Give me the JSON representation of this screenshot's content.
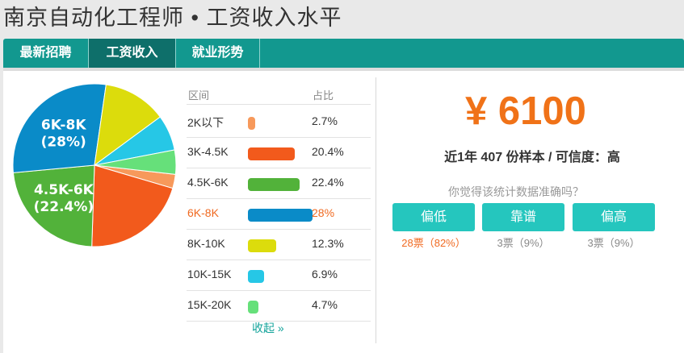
{
  "page": {
    "title": "南京自动化工程师 • 工资收入水平"
  },
  "tabs": [
    {
      "label": "最新招聘",
      "active": false
    },
    {
      "label": "工资收入",
      "active": true
    },
    {
      "label": "就业形势",
      "active": false
    }
  ],
  "colors": {
    "accent": "#12988f",
    "salary": "#f07218",
    "vote_button": "#25c6be"
  },
  "chart_data": {
    "type": "pie",
    "slices": [
      {
        "label": "2K以下",
        "value": 2.7,
        "color": "#f7995b",
        "pie_label": ""
      },
      {
        "label": "3K-4.5K",
        "value": 20.4,
        "color": "#f25a1c",
        "pie_label": ""
      },
      {
        "label": "4.5K-6K",
        "value": 22.4,
        "color": "#52b23a",
        "pie_label": "4.5K-6K\n(22.4%)"
      },
      {
        "label": "6K-8K",
        "value": 28,
        "color": "#0a8bc8",
        "pie_label": "6K-8K\n(28%)"
      },
      {
        "label": "8K-10K",
        "value": 12.3,
        "color": "#dcdc0c",
        "pie_label": ""
      },
      {
        "label": "10K-15K",
        "value": 6.9,
        "color": "#26c7e6",
        "pie_label": ""
      },
      {
        "label": "15K-20K",
        "value": 4.7,
        "color": "#66e07a",
        "pie_label": ""
      }
    ]
  },
  "table": {
    "col_range": "区间",
    "col_share": "占比",
    "rows": [
      {
        "range": "2K以下",
        "share": "2.7%",
        "value": 2.7,
        "color": "#f7995b",
        "highlight": false
      },
      {
        "range": "3K-4.5K",
        "share": "20.4%",
        "value": 20.4,
        "color": "#f25a1c",
        "highlight": false
      },
      {
        "range": "4.5K-6K",
        "share": "22.4%",
        "value": 22.4,
        "color": "#52b23a",
        "highlight": false
      },
      {
        "range": "6K-8K",
        "share": "28%",
        "value": 28,
        "color": "#0a8bc8",
        "highlight": true
      },
      {
        "range": "8K-10K",
        "share": "12.3%",
        "value": 12.3,
        "color": "#dcdc0c",
        "highlight": false
      },
      {
        "range": "10K-15K",
        "share": "6.9%",
        "value": 6.9,
        "color": "#26c7e6",
        "highlight": false
      },
      {
        "range": "15K-20K",
        "share": "4.7%",
        "value": 4.7,
        "color": "#66e07a",
        "highlight": false
      }
    ],
    "collapse": "收起 »"
  },
  "salary": {
    "amount": "¥ 6100",
    "sample_text": "近1年 407 份样本 / 可信度：高",
    "question": "你觉得该统计数据准确吗？"
  },
  "votes": [
    {
      "label": "偏低",
      "count": "28票（82%）",
      "hot": true
    },
    {
      "label": "靠谱",
      "count": "3票（9%）",
      "hot": false
    },
    {
      "label": "偏高",
      "count": "3票（9%）",
      "hot": false
    }
  ]
}
